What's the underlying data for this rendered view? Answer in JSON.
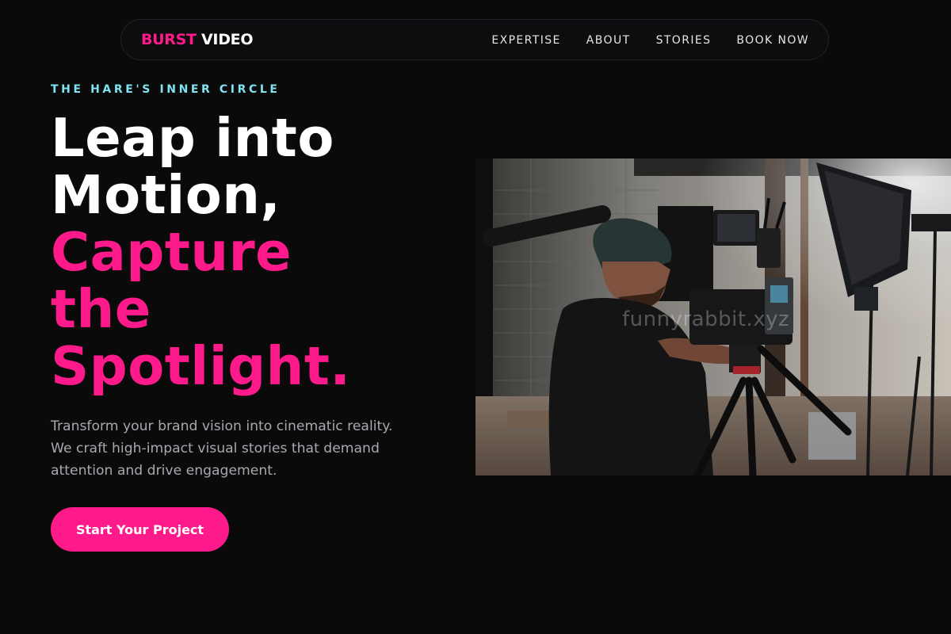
{
  "brand": {
    "part1": "BURST",
    "part2": "VIDEO"
  },
  "nav": {
    "items": [
      {
        "label": "EXPERTISE"
      },
      {
        "label": "ABOUT"
      },
      {
        "label": "STORIES"
      },
      {
        "label": "BOOK NOW"
      }
    ]
  },
  "hero": {
    "eyebrow": "THE HARE'S INNER CIRCLE",
    "headline_white": [
      "Leap into",
      "Motion,"
    ],
    "headline_pink": [
      "Capture",
      "the",
      "Spotlight."
    ],
    "lede": "Transform your brand vision into cinematic reality. We craft high-impact visual stories that demand attention and drive engagement.",
    "cta_label": "Start Your Project"
  },
  "image": {
    "watermark": "funnyrabbit.xyz"
  },
  "colors": {
    "background": "#0a0a0b",
    "accent": "#ff1a8c",
    "eyebrow": "#7fe3f0",
    "body_text": "#a8a8b0"
  }
}
